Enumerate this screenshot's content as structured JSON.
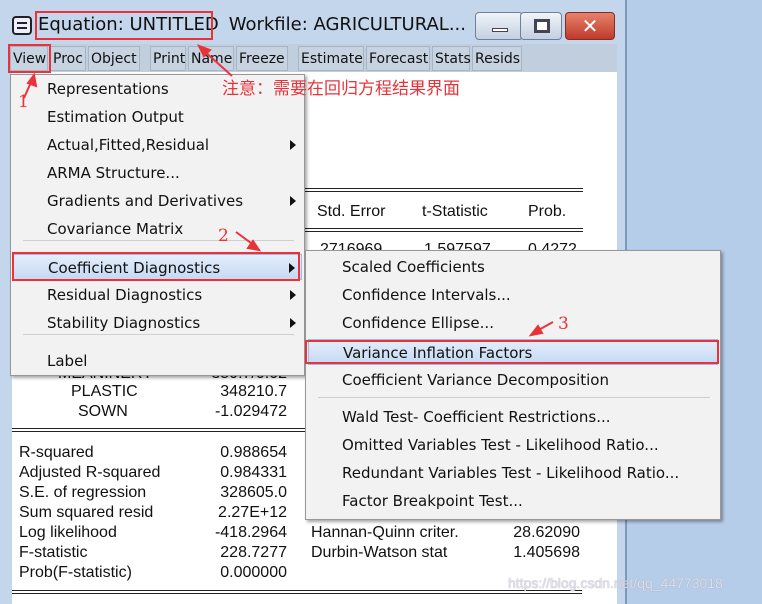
{
  "window": {
    "title": "Equation: UNTITLED",
    "workfile": "Workfile: AGRICULTURAL...",
    "close_glyph": "✕"
  },
  "toolbar": [
    "View",
    "Proc",
    "Object",
    "Print",
    "Name",
    "Freeze",
    "Estimate",
    "Forecast",
    "Stats",
    "Resids"
  ],
  "annotations": {
    "note": "注意：需要在回归方程结果界面",
    "step1": "1",
    "step2": "2",
    "step3": "3",
    "color": "#e8333a"
  },
  "table": {
    "headers": [
      "Std. Error",
      "t-Statistic",
      "Prob."
    ],
    "partial_row": [
      "2716969",
      "1.597597",
      "0.4272"
    ],
    "rows": [
      {
        "var": "PLASTIC",
        "coef": "348210.7"
      },
      {
        "var": "SOWN",
        "coef": "-1.029472"
      }
    ],
    "partial_var": "MEANINERY",
    "partial_coef": "350.7/0.02",
    "stats_left": [
      [
        "R-squared",
        "0.988654"
      ],
      [
        "Adjusted R-squared",
        "0.984331"
      ],
      [
        "S.E. of regression",
        "328605.0"
      ],
      [
        "Sum squared resid",
        "2.27E+12"
      ],
      [
        "Log likelihood",
        "-418.2964"
      ],
      [
        "F-statistic",
        "228.7277"
      ],
      [
        "Prob(F-statistic)",
        "0.000000"
      ]
    ],
    "stats_right": [
      [
        "Hannan-Quinn criter.",
        "28.62090"
      ],
      [
        "Durbin-Watson stat",
        "1.405698"
      ]
    ]
  },
  "view_menu": [
    "Representations",
    "Estimation Output",
    "Actual,Fitted,Residual",
    "ARMA Structure...",
    "Gradients and Derivatives",
    "Covariance Matrix",
    "Coefficient Diagnostics",
    "Residual Diagnostics",
    "Stability Diagnostics",
    "Label"
  ],
  "submenu": [
    "Scaled Coefficients",
    "Confidence Intervals...",
    "Confidence Ellipse...",
    "Variance Inflation Factors",
    "Coefficient Variance Decomposition",
    "Wald Test- Coefficient Restrictions...",
    "Omitted Variables Test - Likelihood Ratio...",
    "Redundant Variables Test - Likelihood Ratio...",
    "Factor Breakpoint Test..."
  ],
  "watermark": "https://blog.csdn.net/qq_44773018"
}
